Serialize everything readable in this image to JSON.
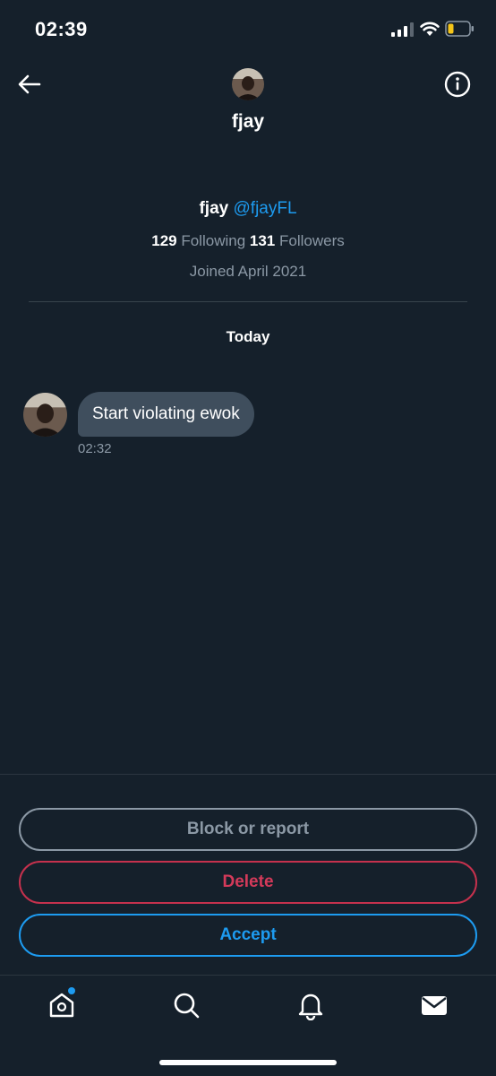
{
  "status_bar": {
    "time": "02:39"
  },
  "header": {
    "title": "fjay"
  },
  "profile": {
    "display_name": "fjay",
    "handle": "@fjayFL",
    "following_count": "129",
    "following_label": "Following",
    "followers_count": "131",
    "followers_label": "Followers",
    "joined": "Joined April 2021"
  },
  "conversation": {
    "day_label": "Today",
    "messages": [
      {
        "text": "Start violating ewok",
        "time": "02:32"
      }
    ]
  },
  "actions": {
    "block_label": "Block or report",
    "delete_label": "Delete",
    "accept_label": "Accept"
  },
  "tab_bar": {
    "items": [
      "home-icon",
      "search-icon",
      "notifications-icon",
      "messages-icon"
    ]
  },
  "colors": {
    "background": "#15202b",
    "accent": "#1d9bf0",
    "danger": "#d43a5a",
    "muted": "#8b98a5",
    "bubble": "#3f4e5d"
  }
}
